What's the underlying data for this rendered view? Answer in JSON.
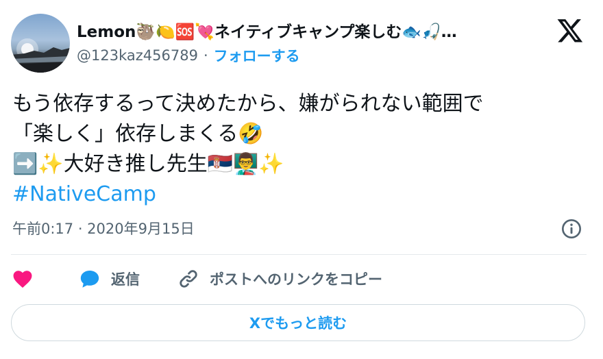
{
  "author": {
    "name": "Lemon🦥🍋🆘💘ネイティブキャンプ楽しむ🐟🎣…",
    "handle": "@123kaz456789",
    "separator": "·",
    "follow_label": "フォローする"
  },
  "tweet": {
    "lines": [
      "もう依存するって決めたから、嫌がられない範囲で",
      "「楽しく」依存しまくる🤣",
      "➡️✨大好き推し先生🇷🇸👨‍🏫✨"
    ],
    "hashtag": "#NativeCamp"
  },
  "meta": {
    "timestamp": "午前0:17 · 2020年9月15日"
  },
  "actions": {
    "reply_label": "返信",
    "copy_link_label": "ポストへのリンクをコピー"
  },
  "read_more_label": "Xでもっと読む",
  "colors": {
    "accent": "#1d9bf0",
    "like": "#f91880",
    "secondary_text": "#536471",
    "border": "#cfd9de"
  },
  "icons": [
    "x-logo-icon",
    "info-icon",
    "heart-icon",
    "reply-bubble-icon",
    "link-icon"
  ]
}
